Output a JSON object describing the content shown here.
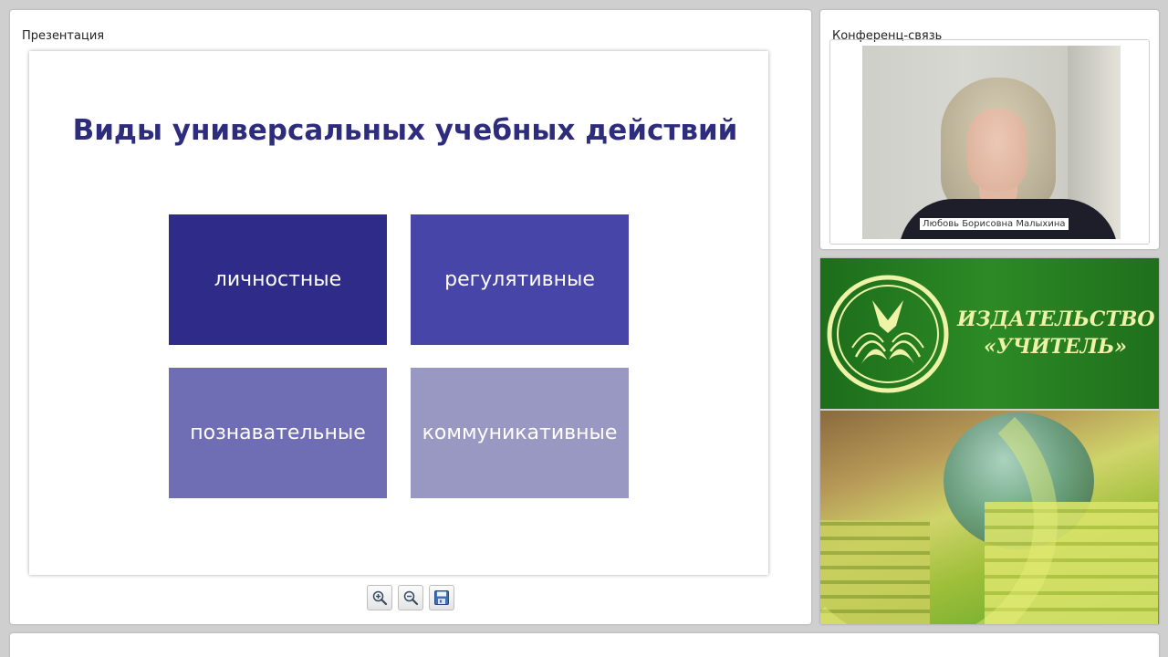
{
  "presentation": {
    "title": "Презентация",
    "slide": {
      "title": "Виды универсальных учебных действий",
      "tiles": [
        {
          "label": "личностные",
          "color": "#2e2c88"
        },
        {
          "label": "регулятивные",
          "color": "#4745a8"
        },
        {
          "label": "познавательные",
          "color": "#6f6db3"
        },
        {
          "label": "коммуникативные",
          "color": "#9998c3"
        }
      ]
    },
    "toolbar": {
      "zoom_in_icon": "zoom-in-icon",
      "zoom_out_icon": "zoom-out-icon",
      "save_icon": "save-icon"
    }
  },
  "conference": {
    "title": "Конференц-связь",
    "speaker_name": "Любовь Борисовна Малыхина"
  },
  "banner": {
    "publisher_line1": "ИЗДАТЕЛЬСТВО",
    "publisher_line2": "«УЧИТЕЛЬ»",
    "accent_color": "#2c8a25",
    "text_color": "#eef3a8"
  }
}
